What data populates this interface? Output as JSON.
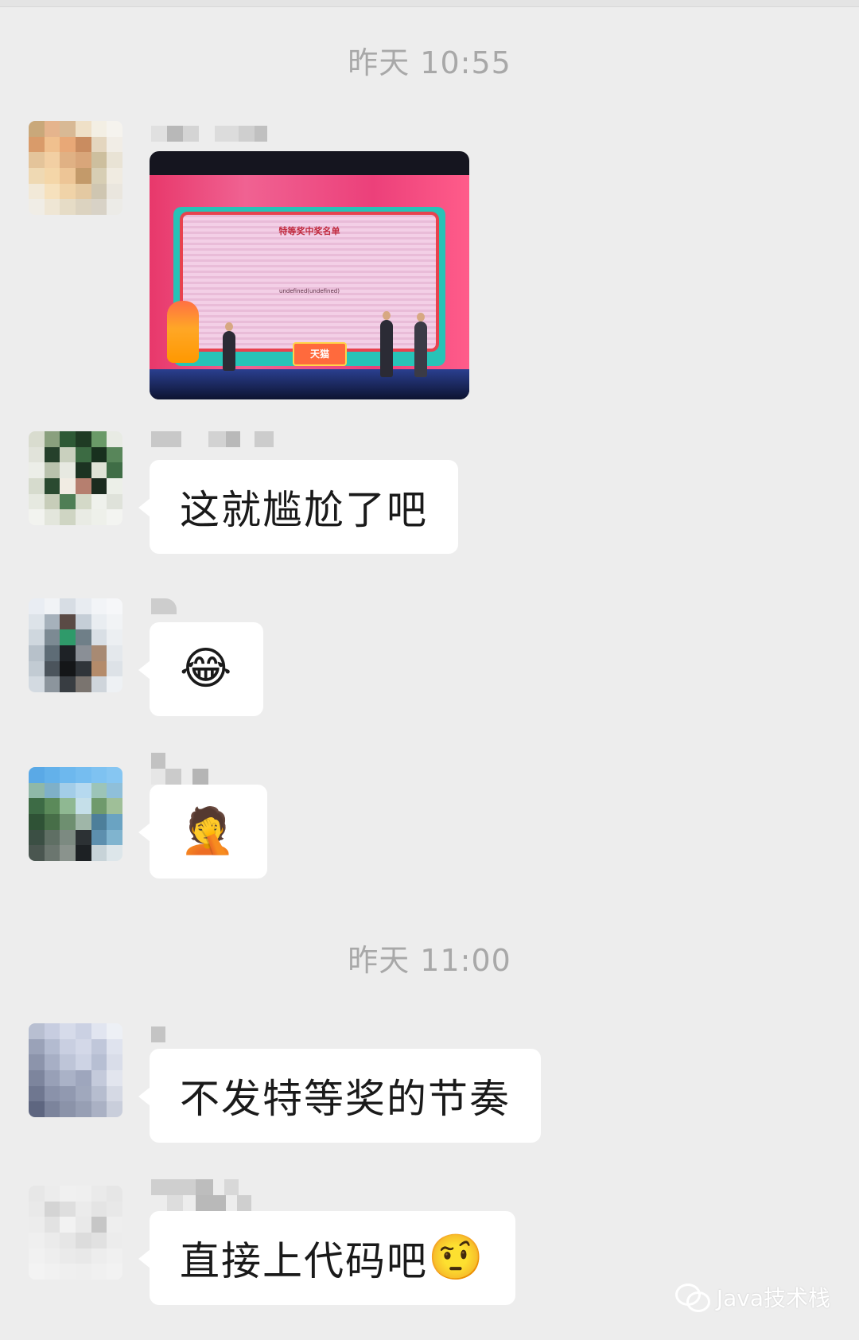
{
  "timestamps": [
    "昨天 10:55",
    "昨天 11:00"
  ],
  "image_message": {
    "screen_title": "特等奖中奖名单",
    "screen_text": "undefined(undefined)",
    "stage_logo": "天猫"
  },
  "messages": [
    {
      "text": "这就尴尬了吧",
      "emoji": ""
    },
    {
      "text": "",
      "emoji": "😂"
    },
    {
      "text": "",
      "emoji": "🤦"
    },
    {
      "text": "不发特等奖的节奏",
      "emoji": ""
    },
    {
      "text": "直接上代码吧",
      "emoji": "🤨"
    }
  ],
  "watermark": {
    "text": "Java技术栈",
    "icon": "wechat-icon"
  }
}
